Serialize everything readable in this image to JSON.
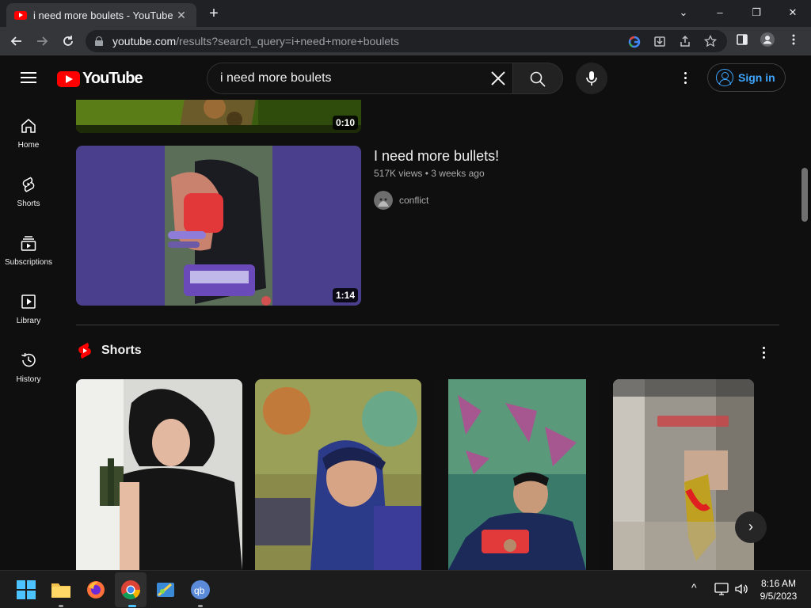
{
  "browser": {
    "tab_title": "i need more boulets - YouTube",
    "tab_close": "✕",
    "new_tab": "+",
    "url_host": "youtube.com",
    "url_path": "/results?search_query=i+need+more+boulets",
    "window_controls": {
      "minimize": "–",
      "restore": "❐",
      "close": "✕",
      "tab_search": "⌄"
    }
  },
  "youtube": {
    "logo_text": "YouTube",
    "search_query": "i need more boulets",
    "signin_label": "Sign in",
    "sidebar": [
      {
        "label": "Home",
        "icon": "home-icon"
      },
      {
        "label": "Shorts",
        "icon": "shorts-icon"
      },
      {
        "label": "Subscriptions",
        "icon": "subscriptions-icon"
      },
      {
        "label": "Library",
        "icon": "library-icon"
      },
      {
        "label": "History",
        "icon": "history-icon"
      }
    ],
    "results": [
      {
        "duration": "0:10"
      },
      {
        "title": "I need more bullets!",
        "views": "517K views",
        "age": "3 weeks ago",
        "meta_separator": "•",
        "channel": "conflict",
        "duration": "1:14"
      }
    ],
    "shorts_section": {
      "title": "Shorts",
      "next": "›"
    }
  },
  "taskbar": {
    "clock_time": "8:16 AM",
    "clock_date": "9/5/2023",
    "tray_chevron": "^"
  },
  "colors": {
    "background": "#0f0f0f",
    "accent_red": "#ff0000",
    "link_blue": "#3ea6ff"
  }
}
